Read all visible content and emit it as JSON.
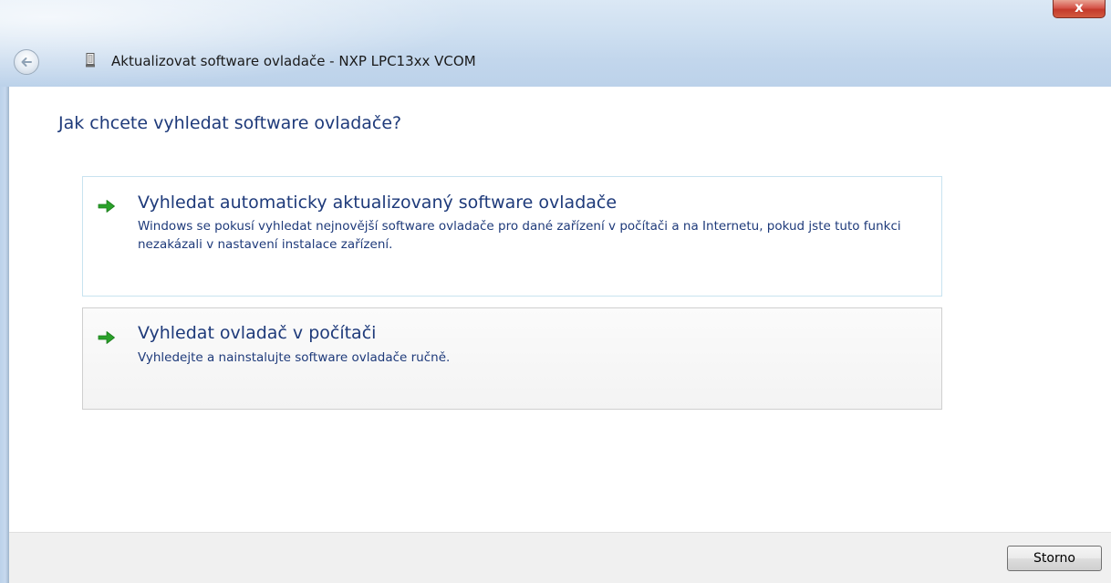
{
  "window": {
    "title": "Aktualizovat software ovladače - NXP LPC13xx VCOM",
    "close_label": "x"
  },
  "heading": "Jak chcete vyhledat software ovladače?",
  "options": [
    {
      "title": "Vyhledat automaticky aktualizovaný software ovladače",
      "description": "Windows se pokusí vyhledat nejnovější software ovladače pro dané zařízení v počítači a na Internetu, pokud jste tuto funkci nezakázali v nastavení instalace zařízení.",
      "icon": "green-arrow-icon"
    },
    {
      "title": "Vyhledat ovladač v počítači",
      "description": "Vyhledejte a nainstalujte software ovladače ručně.",
      "icon": "green-arrow-icon"
    }
  ],
  "footer": {
    "cancel_label": "Storno"
  },
  "colors": {
    "link_text": "#1e3a7a",
    "arrow": "#2aa12a",
    "footer_bg": "#f0f0f0"
  }
}
